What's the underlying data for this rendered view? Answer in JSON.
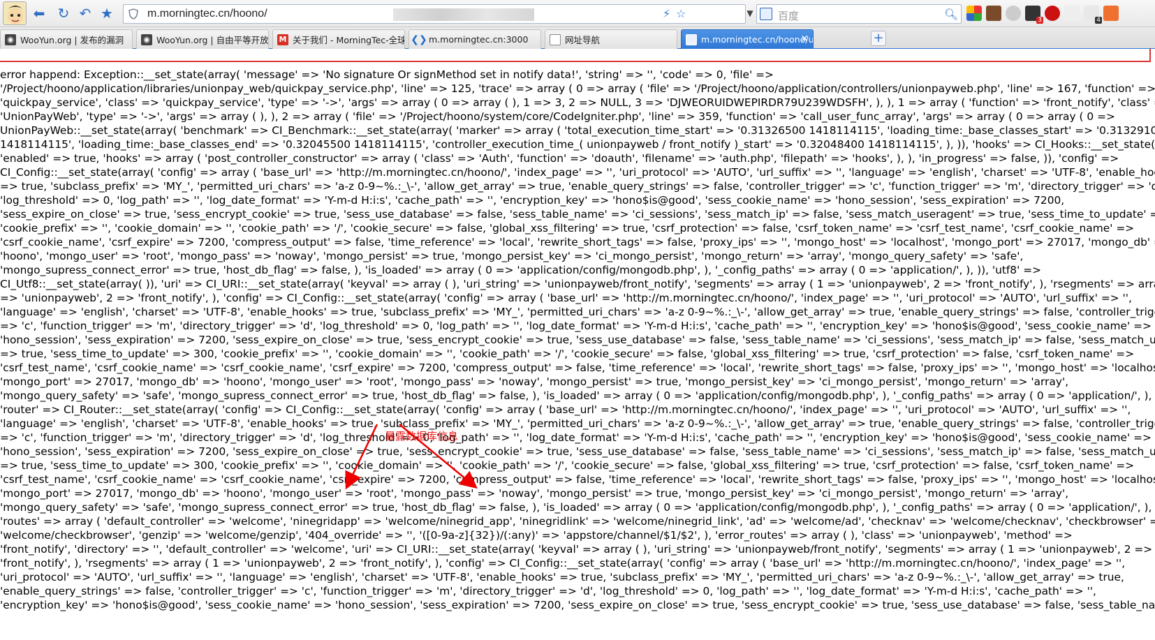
{
  "browser": {
    "address_url": "m.morningtec.cn/hoono/",
    "search_placeholder": "百度",
    "icons": [
      "back-icon",
      "refresh-icon",
      "undo-icon",
      "bookmark-star-icon",
      "security-icon",
      "lightning-icon",
      "star-icon",
      "dropdown-icon",
      "search-icon"
    ],
    "tabs": [
      {
        "label": "WooYun.org | 发布的漏洞",
        "icon": "wooyun-favicon"
      },
      {
        "label": "WooYun.org | 自由平等开放",
        "icon": "wooyun-favicon"
      },
      {
        "label": "关于我们 - MorningTec-全球",
        "icon": "gmail-favicon"
      },
      {
        "label": "m.morningtec.cn:3000",
        "icon": "vscode-favicon"
      },
      {
        "label": "网址导航",
        "icon": "page-favicon"
      },
      {
        "label": "m.morningtec.cn/hoono/u",
        "icon": "page-favicon",
        "active": true
      }
    ],
    "extension_badges": [
      "3",
      "4"
    ]
  },
  "page": {
    "error_lines": [
      "error happend: Exception::__set_state(array( 'message' => 'No signature Or signMethod set in notify data!', 'string' => '', 'code' => 0, 'file' =>",
      "'/Project/hoono/application/libraries/unionpay_web/quickpay_service.php', 'line' => 125, 'trace' => array ( 0 => array ( 'file' => '/Project/hoono/application/controllers/unionpayweb.php', 'line' => 167, 'function' =>",
      "'quickpay_service', 'class' => 'quickpay_service', 'type' => '->', 'args' => array ( 0 => array ( ), 1 => 3, 2 => NULL, 3 => 'DJWEORUIDWEPIRDR79U239WDSFH', ), ), 1 => array ( 'function' => 'front_notify', 'class' =>",
      "'UnionPayWeb', 'type' => '->', 'args' => array ( ), ), 2 => array ( 'file' => '/Project/hoono/system/core/CodeIgniter.php', 'line' => 359, 'function' => 'call_user_func_array', 'args' => array ( 0 => array ( 0 =>",
      "UnionPayWeb::__set_state(array( 'benchmark' => CI_Benchmark::__set_state(array( 'marker' => array ( 'total_execution_time_start' => '0.31326500 1418114115', 'loading_time:_base_classes_start' => '0.31329100",
      "1418114115', 'loading_time:_base_classes_end' => '0.32045500 1418114115', 'controller_execution_time_( unionpayweb / front_notify )_start' => '0.32048400 1418114115', ), )), 'hooks' => CI_Hooks::__set_state(array(",
      "'enabled' => true, 'hooks' => array ( 'post_controller_constructor' => array ( 'class' => 'Auth', 'function' => 'doauth', 'filename' => 'auth.php', 'filepath' => 'hooks', ), ), 'in_progress' => false, )), 'config' =>",
      "CI_Config::__set_state(array( 'config' => array ( 'base_url' => 'http://m.morningtec.cn/hoono/', 'index_page' => '', 'uri_protocol' => 'AUTO', 'url_suffix' => '', 'language' => 'english', 'charset' => 'UTF-8', 'enable_hooks'",
      "=> true, 'subclass_prefix' => 'MY_', 'permitted_uri_chars' => 'a-z 0-9~%.:_\\-', 'allow_get_array' => true, 'enable_query_strings' => false, 'controller_trigger' => 'c', 'function_trigger' => 'm', 'directory_trigger' => 'd',",
      "'log_threshold' => 0, 'log_path' => '', 'log_date_format' => 'Y-m-d H:i:s', 'cache_path' => '', 'encryption_key' => 'hono$is@good', 'sess_cookie_name' => 'hono_session', 'sess_expiration' => 7200,",
      "'sess_expire_on_close' => true, 'sess_encrypt_cookie' => true, 'sess_use_database' => false, 'sess_table_name' => 'ci_sessions', 'sess_match_ip' => false, 'sess_match_useragent' => true, 'sess_time_to_update' => 300,",
      "'cookie_prefix' => '', 'cookie_domain' => '', 'cookie_path' => '/', 'cookie_secure' => false, 'global_xss_filtering' => true, 'csrf_protection' => false, 'csrf_token_name' => 'csrf_test_name', 'csrf_cookie_name' =>",
      "'csrf_cookie_name', 'csrf_expire' => 7200, 'compress_output' => false, 'time_reference' => 'local', 'rewrite_short_tags' => false, 'proxy_ips' => '', 'mongo_host' => 'localhost', 'mongo_port' => 27017, 'mongo_db' =>",
      "'hoono', 'mongo_user' => 'root', 'mongo_pass' => 'noway', 'mongo_persist' => true, 'mongo_persist_key' => 'ci_mongo_persist', 'mongo_return' => 'array', 'mongo_query_safety' => 'safe',",
      "'mongo_supress_connect_error' => true, 'host_db_flag' => false, ), 'is_loaded' => array ( 0 => 'application/config/mongodb.php', ), '_config_paths' => array ( 0 => 'application/', ), )), 'utf8' =>",
      "CI_Utf8::__set_state(array( )), 'uri' => CI_URI::__set_state(array( 'keyval' => array ( ), 'uri_string' => 'unionpayweb/front_notify', 'segments' => array ( 1 => 'unionpayweb', 2 => 'front_notify', ), 'rsegments' => array ( 1",
      "=> 'unionpayweb', 2 => 'front_notify', ), 'config' => CI_Config::__set_state(array( 'config' => array ( 'base_url' => 'http://m.morningtec.cn/hoono/', 'index_page' => '', 'uri_protocol' => 'AUTO', 'url_suffix' => '',",
      "'language' => 'english', 'charset' => 'UTF-8', 'enable_hooks' => true, 'subclass_prefix' => 'MY_', 'permitted_uri_chars' => 'a-z 0-9~%.:_\\-', 'allow_get_array' => true, 'enable_query_strings' => false, 'controller_trigger'",
      "=> 'c', 'function_trigger' => 'm', 'directory_trigger' => 'd', 'log_threshold' => 0, 'log_path' => '', 'log_date_format' => 'Y-m-d H:i:s', 'cache_path' => '', 'encryption_key' => 'hono$is@good', 'sess_cookie_name' =>",
      "'hono_session', 'sess_expiration' => 7200, 'sess_expire_on_close' => true, 'sess_encrypt_cookie' => true, 'sess_use_database' => false, 'sess_table_name' => 'ci_sessions', 'sess_match_ip' => false, 'sess_match_useragent'",
      "=> true, 'sess_time_to_update' => 300, 'cookie_prefix' => '', 'cookie_domain' => '', 'cookie_path' => '/', 'cookie_secure' => false, 'global_xss_filtering' => true, 'csrf_protection' => false, 'csrf_token_name' =>",
      "'csrf_test_name', 'csrf_cookie_name' => 'csrf_cookie_name', 'csrf_expire' => 7200, 'compress_output' => false, 'time_reference' => 'local', 'rewrite_short_tags' => false, 'proxy_ips' => '', 'mongo_host' => 'localhost',",
      "'mongo_port' => 27017, 'mongo_db' => 'hoono', 'mongo_user' => 'root', 'mongo_pass' => 'noway', 'mongo_persist' => true, 'mongo_persist_key' => 'ci_mongo_persist', 'mongo_return' => 'array',",
      "'mongo_query_safety' => 'safe', 'mongo_supress_connect_error' => true, 'host_db_flag' => false, ), 'is_loaded' => array ( 0 => 'application/config/mongodb.php', ), '_config_paths' => array ( 0 => 'application/', ), )), )),",
      "'router' => CI_Router::__set_state(array( 'config' => CI_Config::__set_state(array( 'config' => array ( 'base_url' => 'http://m.morningtec.cn/hoono/', 'index_page' => '', 'uri_protocol' => 'AUTO', 'url_suffix' => '',",
      "'language' => 'english', 'charset' => 'UTF-8', 'enable_hooks' => true, 'subclass_prefix' => 'MY_', 'permitted_uri_chars' => 'a-z 0-9~%.:_\\-', 'allow_get_array' => true, 'enable_query_strings' => false, 'controller_trigger'",
      "=> 'c', 'function_trigger' => 'm', 'directory_trigger' => 'd', 'log_threshold' => 0, 'log_path' => '', 'log_date_format' => 'Y-m-d H:i:s', 'cache_path' => '', 'encryption_key' => 'hono$is@good', 'sess_cookie_name' =>",
      "'hono_session', 'sess_expiration' => 7200, 'sess_expire_on_close' => true, 'sess_encrypt_cookie' => true, 'sess_use_database' => false, 'sess_table_name' => 'ci_sessions', 'sess_match_ip' => false, 'sess_match_useragent'",
      "=> true, 'sess_time_to_update' => 300, 'cookie_prefix' => '', 'cookie_domain' => '', 'cookie_path' => '/', 'cookie_secure' => false, 'global_xss_filtering' => true, 'csrf_protection' => false, 'csrf_token_name' =>",
      "'csrf_test_name', 'csrf_cookie_name' => 'csrf_cookie_name', 'csrf_expire' => 7200, 'compress_output' => false, 'time_reference' => 'local', 'rewrite_short_tags' => false, 'proxy_ips' => '', 'mongo_host' => 'localhost',",
      "'mongo_port' => 27017, 'mongo_db' => 'hoono', 'mongo_user' => 'root', 'mongo_pass' => 'noway', 'mongo_persist' => true, 'mongo_persist_key' => 'ci_mongo_persist', 'mongo_return' => 'array',",
      "'mongo_query_safety' => 'safe', 'mongo_supress_connect_error' => true, 'host_db_flag' => false, ), 'is_loaded' => array ( 0 => 'application/config/mongodb.php', ), '_config_paths' => array ( 0 => 'application/', ), )),",
      "'routes' => array ( 'default_controller' => 'welcome', 'ninegridapp' => 'welcome/ninegrid_app', 'ninegridlink' => 'welcome/ninegrid_link', 'ad' => 'welcome/ad', 'checknav' => 'welcome/checknav', 'checkbrowser' =>",
      "'welcome/checkbrowser', 'genzip' => 'welcome/genzip', '404_override' => '', '([0-9a-z]{32})/(:any)' => 'appstore/channel/$1/$2', ), 'error_routes' => array ( ), 'class' => 'unionpayweb', 'method' =>",
      "'front_notify', 'directory' => '', 'default_controller' => 'welcome', 'uri' => CI_URI::__set_state(array( 'keyval' => array ( ), 'uri_string' => 'unionpayweb/front_notify', 'segments' => array ( 1 => 'unionpayweb', 2 =>",
      "'front_notify', ), 'rsegments' => array ( 1 => 'unionpayweb', 2 => 'front_notify', ), 'config' => CI_Config::__set_state(array( 'config' => array ( 'base_url' => 'http://m.morningtec.cn/hoono/', 'index_page' => '',",
      "'uri_protocol' => 'AUTO', 'url_suffix' => '', 'language' => 'english', 'charset' => 'UTF-8', 'enable_hooks' => true, 'subclass_prefix' => 'MY_', 'permitted_uri_chars' => 'a-z 0-9~%.:_\\-', 'allow_get_array' => true,",
      "'enable_query_strings' => false, 'controller_trigger' => 'c', 'function_trigger' => 'm', 'directory_trigger' => 'd', 'log_threshold' => 0, 'log_path' => '', 'log_date_format' => 'Y-m-d H:i:s', 'cache_path' => '',",
      "'encryption_key' => 'hono$is@good', 'sess_cookie_name' => 'hono_session', 'sess_expiration' => 7200, 'sess_expire_on_close' => true, 'sess_encrypt_cookie' => true, 'sess_use_database' => false, 'sess_table_name' =>"
    ],
    "annotation": "暴露数据库信息",
    "annotation_color": "#e00000"
  }
}
